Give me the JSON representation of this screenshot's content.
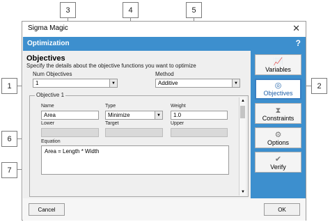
{
  "callouts": [
    "1",
    "2",
    "3",
    "4",
    "5",
    "6",
    "7"
  ],
  "window": {
    "title": "Sigma Magic",
    "close_glyph": "✕"
  },
  "header": {
    "title": "Optimization",
    "help_glyph": "?"
  },
  "main": {
    "title": "Objectives",
    "description": "Specify the details about the objective functions you want to optimize",
    "num_objectives_label": "Num Objectives",
    "num_objectives_value": "1",
    "method_label": "Method",
    "method_value": "Additive",
    "frame_label": "Objective 1",
    "name_label": "Name",
    "name_value": "Area",
    "type_label": "Type",
    "type_value": "Minimize",
    "weight_label": "Weight",
    "weight_value": "1.0",
    "lower_label": "Lower",
    "target_label": "Target",
    "upper_label": "Upper",
    "equation_label": "Equation",
    "equation_value": "Area = Length * Width"
  },
  "sidebar": {
    "items": [
      {
        "label": "Variables",
        "icon": "line-chart-icon"
      },
      {
        "label": "Objectives",
        "icon": "target-icon",
        "active": true
      },
      {
        "label": "Constraints",
        "icon": "hourglass-icon"
      },
      {
        "label": "Options",
        "icon": "gear-icon"
      },
      {
        "label": "Verify",
        "icon": "check-icon"
      }
    ]
  },
  "footer": {
    "cancel_label": "Cancel",
    "ok_label": "OK"
  },
  "colors": {
    "accent": "#3d8fce",
    "active_border": "#3a7fc0"
  }
}
